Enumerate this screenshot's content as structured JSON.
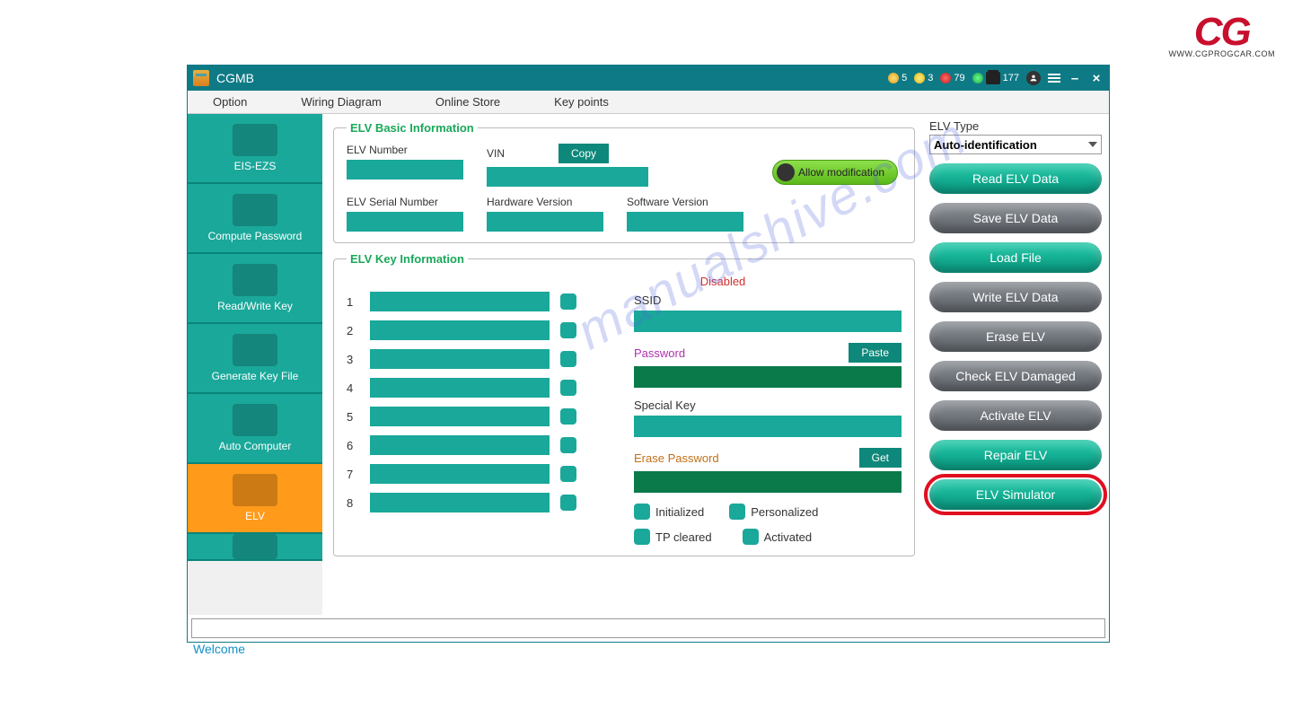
{
  "brand": {
    "text": "CG",
    "url": "WWW.CGPROGCAR.COM"
  },
  "titlebar": {
    "title": "CGMB",
    "counters": {
      "gold": "5",
      "gold2": "3",
      "red": "79",
      "green": "177"
    }
  },
  "menubar": [
    "Option",
    "Wiring Diagram",
    "Online Store",
    "Key points"
  ],
  "sidebar": [
    {
      "label": "EIS-EZS"
    },
    {
      "label": "Compute Password"
    },
    {
      "label": "Read/Write Key"
    },
    {
      "label": "Generate Key File"
    },
    {
      "label": "Auto Computer"
    },
    {
      "label": "ELV",
      "active": true
    },
    {
      "label": ""
    }
  ],
  "basic": {
    "legend": "ELV Basic Information",
    "elv_number_lbl": "ELV Number",
    "vin_lbl": "VIN",
    "copy": "Copy",
    "serial_lbl": "ELV Serial Number",
    "hw_lbl": "Hardware Version",
    "sw_lbl": "Software Version",
    "allow_mod": "Allow modification"
  },
  "keyinfo": {
    "legend": "ELV Key Information",
    "disabled_hdr": "Disabled",
    "rows": [
      "1",
      "2",
      "3",
      "4",
      "5",
      "6",
      "7",
      "8"
    ],
    "ssid_lbl": "SSID",
    "pwd_lbl": "Password",
    "paste": "Paste",
    "special_lbl": "Special Key",
    "erase_lbl": "Erase Password",
    "get": "Get",
    "status": {
      "initialized": "Initialized",
      "personalized": "Personalized",
      "tp": "TP cleared",
      "activated": "Activated"
    }
  },
  "right": {
    "type_lbl": "ELV Type",
    "type_value": "Auto-identification",
    "buttons": [
      {
        "label": "Read ELV Data",
        "style": "teal"
      },
      {
        "label": "Save ELV Data",
        "style": "gray"
      },
      {
        "label": "Load File",
        "style": "teal"
      },
      {
        "label": "Write ELV Data",
        "style": "gray"
      },
      {
        "label": "Erase ELV",
        "style": "gray"
      },
      {
        "label": "Check ELV Damaged",
        "style": "gray"
      },
      {
        "label": "Activate ELV",
        "style": "gray"
      },
      {
        "label": "Repair ELV",
        "style": "teal"
      },
      {
        "label": "ELV Simulator",
        "style": "teal",
        "highlight": true
      }
    ]
  },
  "status_text": "Welcome",
  "watermark": "manualshive.com"
}
